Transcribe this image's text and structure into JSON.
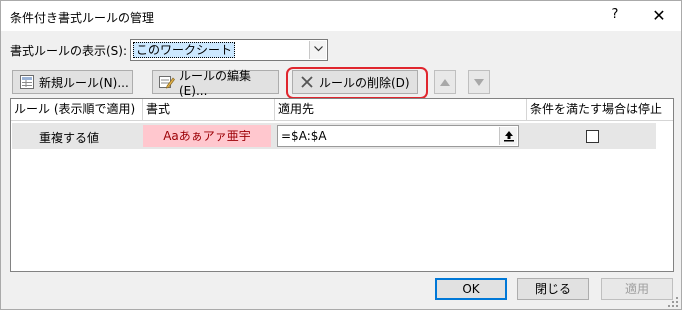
{
  "window": {
    "title": "条件付き書式ルールの管理",
    "help": "?",
    "close": "✕"
  },
  "scope": {
    "label": "書式ルールの表示(S):",
    "value": "このワークシート"
  },
  "toolbar": {
    "new_rule": "新規ルール(N)...",
    "edit_rule": "ルールの編集(E)...",
    "delete_rule": "ルールの削除(D)",
    "highlight_color": "#e0262e"
  },
  "grid": {
    "columns": [
      "ルール (表示順で適用)",
      "書式",
      "適用先",
      "条件を満たす場合は停止"
    ],
    "rows": [
      {
        "rule": "重複する値",
        "format_preview": "Aaあぁアァ亜宇",
        "applies_to": "=$A:$A",
        "stop_if_true": false
      }
    ]
  },
  "buttons": {
    "ok": "OK",
    "close": "閉じる",
    "apply": "適用"
  },
  "colors": {
    "format_fill": "#ffc7ce",
    "format_text": "#9c0006",
    "selection": "#cce8ff",
    "default_button_border": "#0078d7"
  }
}
